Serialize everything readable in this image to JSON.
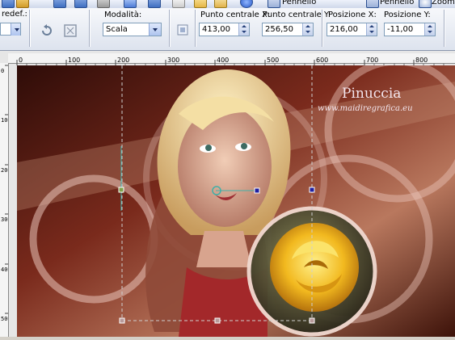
{
  "topbar": {
    "left_label": "redef.:",
    "right_label_1": "Pennello",
    "right_label_2": "Pennello",
    "right_label_3": "Zoom"
  },
  "options": {
    "mode_label": "Modalità:",
    "mode_value": "Scala",
    "center_x_label": "Punto centrale X:",
    "center_x_value": "413,00",
    "center_y_label": "Punto centrale Y:",
    "center_y_value": "256,50",
    "pos_x_label": "Posizione X:",
    "pos_x_value": "216,00",
    "pos_y_label": "Posizione Y:",
    "pos_y_value": "-11,00"
  },
  "ruler": {
    "h_ticks": [
      "0",
      "100",
      "200",
      "300",
      "400",
      "500",
      "600",
      "700",
      "800"
    ],
    "v_ticks": [
      "0",
      "100",
      "200",
      "300",
      "400",
      "500"
    ]
  },
  "canvas": {
    "title": "Pinuccia",
    "url": "www.maidiregrafica.eu"
  },
  "colors": {
    "bg_dark": "#4a1710",
    "bg_mid": "#8a3a2a",
    "accent_rose": "#f4c230",
    "handle": "#1f1fa0"
  }
}
